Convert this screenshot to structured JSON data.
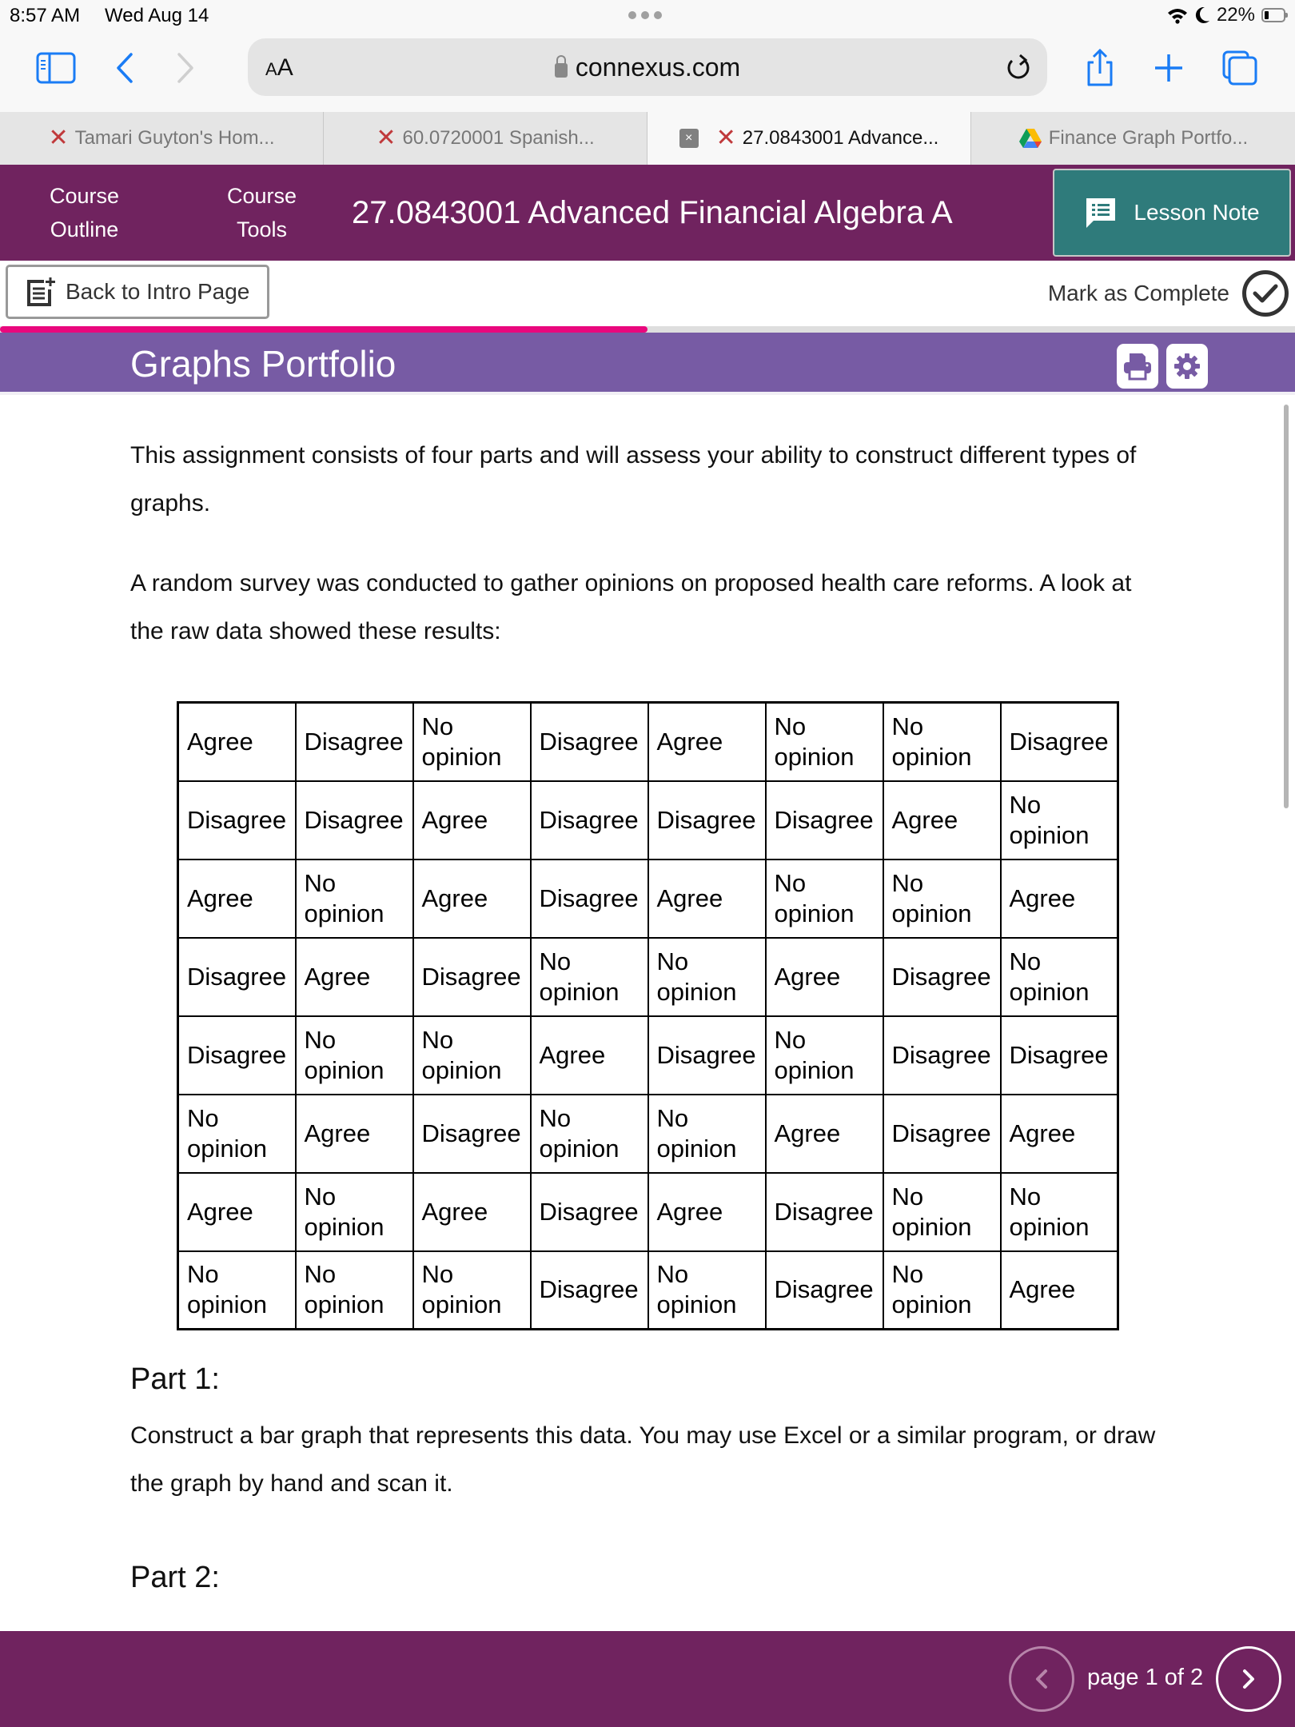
{
  "status_bar": {
    "time": "8:57 AM",
    "date": "Wed Aug 14",
    "battery": "22%",
    "icons": [
      "wifi-icon",
      "moon-icon",
      "battery-icon"
    ]
  },
  "browser": {
    "text_size_label_small": "A",
    "text_size_label_large": "A",
    "url": "connexus.com",
    "icons": [
      "sidebar-icon",
      "back-icon",
      "forward-icon",
      "lock-icon",
      "reload-icon",
      "share-icon",
      "new-tab-icon",
      "tabs-icon"
    ]
  },
  "tabs": [
    {
      "title": "Tamari Guyton's Hom...",
      "icon": "connexus-icon",
      "active": false
    },
    {
      "title": "60.0720001 Spanish...",
      "icon": "connexus-icon",
      "active": false
    },
    {
      "title": "27.0843001 Advance...",
      "icon": "connexus-icon",
      "active": true,
      "close_label": "×"
    },
    {
      "title": "Finance Graph Portfo...",
      "icon": "google-drive-icon",
      "active": false
    }
  ],
  "course_header": {
    "nav": [
      {
        "line1": "Course",
        "line2": "Outline"
      },
      {
        "line1": "Course",
        "line2": "Tools"
      }
    ],
    "title": "27.0843001 Advanced Financial Algebra A",
    "lesson_note_label": "Lesson Note"
  },
  "actions": {
    "back_label": "Back to Intro Page",
    "mark_complete_label": "Mark as Complete"
  },
  "progress": {
    "fraction": 0.5
  },
  "colors": {
    "course_purple": "#70235f",
    "section_purple": "#775ba4",
    "lesson_note_teal": "#2f7b7b",
    "progress_pink": "#e9087d",
    "ios_blue": "#1a7cf5"
  },
  "section": {
    "title": "Graphs Portfolio",
    "tools": [
      "print-icon",
      "settings-icon"
    ]
  },
  "content": {
    "intro": "This assignment consists of four parts and will assess your ability to construct different types of graphs.",
    "survey_intro": "A random survey was conducted to gather opinions on proposed health care reforms. A look at the raw data showed these results:",
    "table": [
      [
        "Agree",
        "Disagree",
        "No opinion",
        "Disagree",
        "Agree",
        "No opinion",
        "No opinion",
        "Disagree"
      ],
      [
        "Disagree",
        "Disagree",
        "Agree",
        "Disagree",
        "Disagree",
        "Disagree",
        "Agree",
        "No opinion"
      ],
      [
        "Agree",
        "No opinion",
        "Agree",
        "Disagree",
        "Agree",
        "No opinion",
        "No opinion",
        "Agree"
      ],
      [
        "Disagree",
        "Agree",
        "Disagree",
        "No opinion",
        "No opinion",
        "Agree",
        "Disagree",
        "No opinion"
      ],
      [
        "Disagree",
        "No opinion",
        "No opinion",
        "Agree",
        "Disagree",
        "No opinion",
        "Disagree",
        "Disagree"
      ],
      [
        "No opinion",
        "Agree",
        "Disagree",
        "No opinion",
        "No opinion",
        "Agree",
        "Disagree",
        "Agree"
      ],
      [
        "Agree",
        "No opinion",
        "Agree",
        "Disagree",
        "Agree",
        "Disagree",
        "No opinion",
        "No opinion"
      ],
      [
        "No opinion",
        "No opinion",
        "No opinion",
        "Disagree",
        "No opinion",
        "Disagree",
        "No opinion",
        "Agree"
      ]
    ],
    "part1_heading": "Part 1:",
    "part1_text": "Construct a bar graph that represents this data. You may use Excel or a similar program, or draw the graph by hand and scan it.",
    "part2_heading": "Part 2:"
  },
  "footer": {
    "page_label": "page 1 of 2",
    "current_page": 1,
    "total_pages": 2
  }
}
